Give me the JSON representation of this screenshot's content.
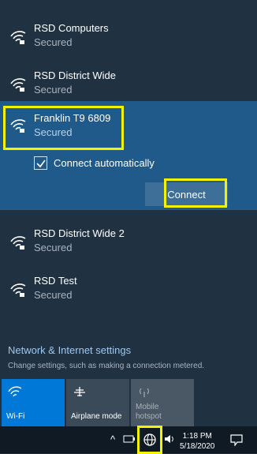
{
  "networks": [
    {
      "name": "RSD Computers",
      "status": "Secured"
    },
    {
      "name": "RSD District Wide",
      "status": "Secured"
    },
    {
      "name": "Franklin T9 6809",
      "status": "Secured",
      "selected": true
    },
    {
      "name": "RSD District Wide 2",
      "status": "Secured"
    },
    {
      "name": "RSD Test",
      "status": "Secured"
    }
  ],
  "selected_panel": {
    "connect_automatically_label": "Connect automatically",
    "connect_automatically_checked": true,
    "connect_button_label": "Connect"
  },
  "settings": {
    "title": "Network & Internet settings",
    "subtitle": "Change settings, such as making a connection metered."
  },
  "quick_actions": [
    {
      "label": "Wi-Fi",
      "icon": "wifi-icon",
      "active": true
    },
    {
      "label": "Airplane mode",
      "icon": "airplane-icon",
      "active": false
    },
    {
      "label": "Mobile hotspot",
      "icon": "hotspot-icon",
      "active": false,
      "disabled": true
    }
  ],
  "taskbar": {
    "time": "1:18 PM",
    "date": "5/18/2020",
    "icons": [
      "chevron-up-icon",
      "battery-icon",
      "network-globe-icon",
      "volume-icon",
      "notification-icon"
    ]
  },
  "colors": {
    "panel_bg": "#203142",
    "selected_bg": "#1f5a8a",
    "accent": "#0078d7",
    "highlight": "#f3f300",
    "link": "#9ec9f0"
  }
}
